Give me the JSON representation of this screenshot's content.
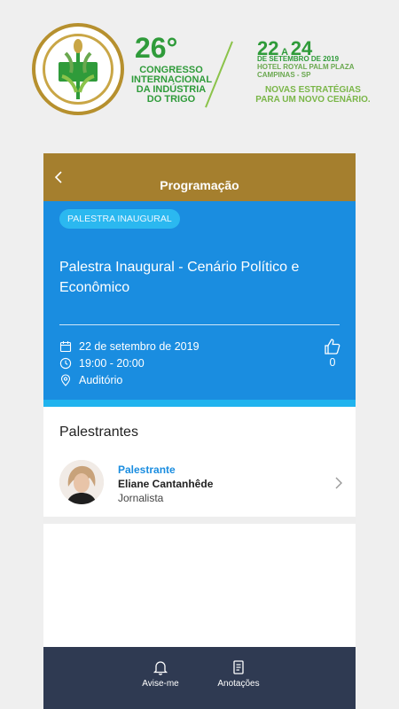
{
  "banner": {
    "number": "26°",
    "title_lines": [
      "CONGRESSO",
      "INTERNACIONAL",
      "DA INDÚSTRIA",
      "DO TRIGO"
    ],
    "date_main": "22",
    "date_a": "A",
    "date_end": "24",
    "date_sub": "DE SETEMBRO DE 2019",
    "hotel": "HOTEL ROYAL PALM PLAZA",
    "city": "CAMPINAS - SP",
    "tagline_1": "NOVAS ESTRATÉGIAS",
    "tagline_2": "PARA UM NOVO CENÁRIO."
  },
  "header": {
    "title": "Programação"
  },
  "event": {
    "category": "PALESTRA INAUGURAL",
    "title": "Palestra Inaugural - Cenário Político e Econômico",
    "date": "22 de setembro de 2019",
    "time": "19:00 - 20:00",
    "location": "Auditório",
    "likes": "0"
  },
  "speakers_section": {
    "title": "Palestrantes",
    "items": [
      {
        "role": "Palestrante",
        "name": "Eliane Cantanhêde",
        "job": "Jornalista"
      }
    ]
  },
  "bottom_nav": {
    "items": [
      {
        "label": "Avise-me",
        "icon": "bell-icon"
      },
      {
        "label": "Anotações",
        "icon": "notes-icon"
      }
    ]
  },
  "colors": {
    "header": "#a57f2e",
    "hero": "#1a8de0",
    "accent_strip": "#20b3ee",
    "nav": "#2f3a52",
    "brand_green": "#2f9b3a"
  }
}
